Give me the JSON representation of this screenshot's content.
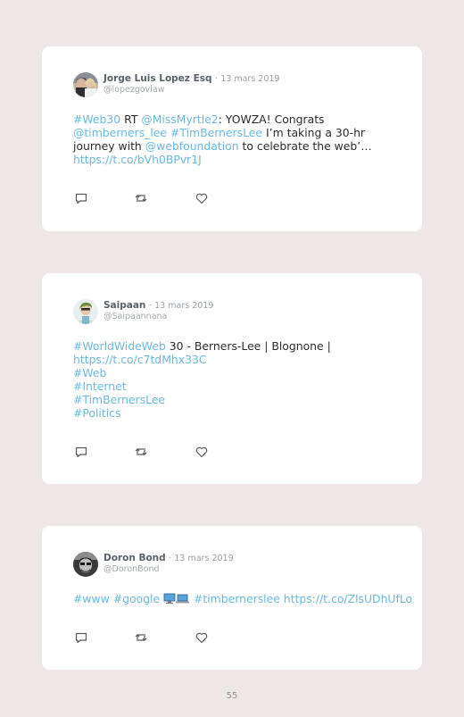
{
  "colors": {
    "background": "#efe6e8",
    "card": "#ffffff",
    "link": "#6cb8e0",
    "name": "#5b6169",
    "meta": "#9aa0a6"
  },
  "tweets": [
    {
      "name": "Jorge Luis Lopez Esq",
      "separator": "·",
      "date": "13 mars 2019",
      "handle": "@lopezgovlaw",
      "avatar_icon": "avatar-photo-couple-icon",
      "lines": [
        [
          "#Web30",
          " RT ",
          "@MissMyrtle2",
          ": YOWZA! Congrats"
        ],
        [
          "@timberners_lee",
          " ",
          "#TimBernersLee",
          " I’m taking a 30-hr"
        ],
        [
          "journey with ",
          "@webfoundation",
          " to celebrate the web’…"
        ],
        [
          "https://t.co/bVh0BPvr1J"
        ]
      ]
    },
    {
      "name": "Saipaan",
      "separator": "·",
      "date": "13 mars 2019",
      "handle": "@Saipaannana",
      "avatar_icon": "avatar-photo-person-icon",
      "lines": [
        [
          "#WorldWideWeb",
          " 30 - Berners-Lee | Blognone |"
        ],
        [
          "https://t.co/c7tdMhx33C"
        ],
        [
          "#Web"
        ],
        [
          "#Internet"
        ],
        [
          "#TimBernersLee"
        ],
        [
          "#Politics"
        ]
      ]
    },
    {
      "name": "Doron Bond",
      "separator": "·",
      "date": "13 mars 2019",
      "handle": "@DoronBond",
      "avatar_icon": "avatar-photo-bw-person-icon",
      "lines": [
        [
          "#www",
          " ",
          "#google",
          " ",
          "#timbernerslee",
          " ",
          "https://t.co/ZlsUDhUfLo"
        ]
      ],
      "emoji_icon": "computer-emoji-icon"
    }
  ],
  "action_icons": [
    "reply-icon",
    "retweet-icon",
    "like-icon"
  ],
  "page_number": "55"
}
